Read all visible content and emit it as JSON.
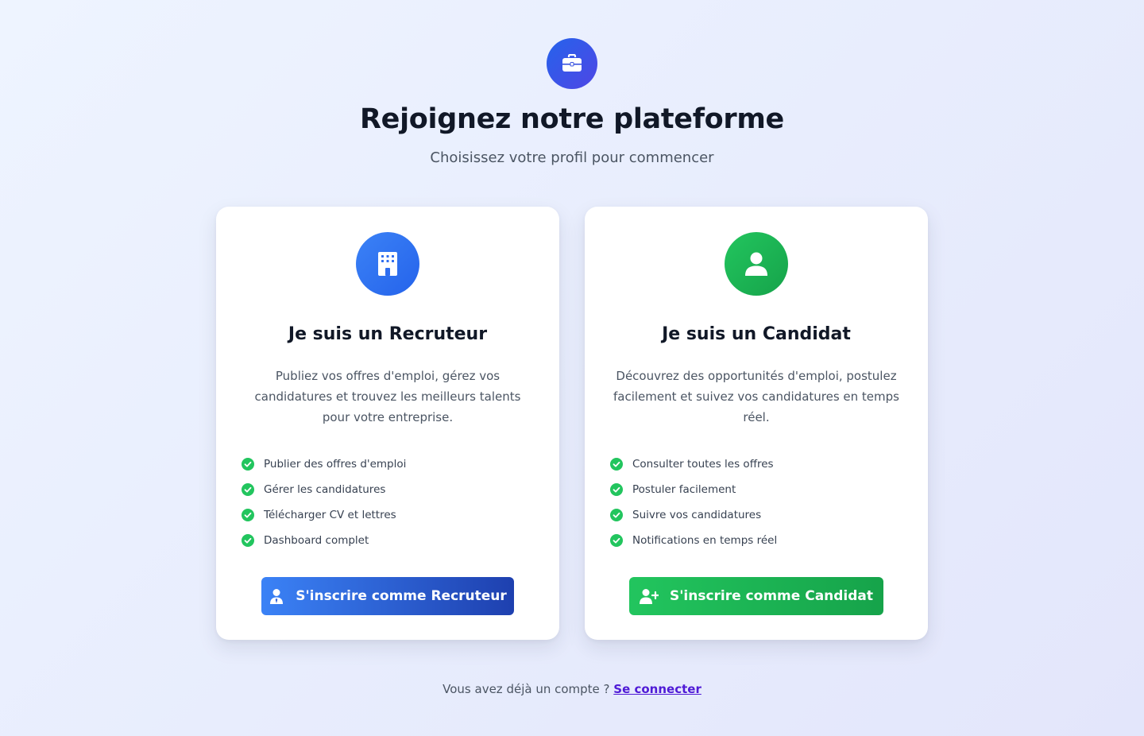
{
  "header": {
    "logo_icon": "briefcase-icon",
    "title": "Rejoignez notre plateforme",
    "subtitle": "Choisissez votre profil pour commencer"
  },
  "cards": {
    "recruiter": {
      "icon": "building-icon",
      "accent_color": "#2563eb",
      "title": "Je suis un Recruteur",
      "description": "Publiez vos offres d'emploi, gérez vos candidatures et trouvez les meilleurs talents pour votre entreprise.",
      "features": [
        "Publier des offres d'emploi",
        "Gérer les candidatures",
        "Télécharger CV et lettres",
        "Dashboard complet"
      ],
      "button_icon": "user-tie-icon",
      "button_label": "S'inscrire comme Recruteur"
    },
    "candidate": {
      "icon": "user-icon",
      "accent_color": "#16a34a",
      "title": "Je suis un Candidat",
      "description": "Découvrez des opportunités d'emploi, postulez facilement et suivez vos candidatures en temps réel.",
      "features": [
        "Consulter toutes les offres",
        "Postuler facilement",
        "Suivre vos candidatures",
        "Notifications en temps réel"
      ],
      "button_icon": "user-plus-icon",
      "button_label": "S'inscrire comme Candidat"
    }
  },
  "footer": {
    "prompt": "Vous avez déjà un compte ?",
    "login_link": "Se connecter"
  },
  "colors": {
    "check": "#22c55e",
    "link": "#4f1ad6"
  }
}
